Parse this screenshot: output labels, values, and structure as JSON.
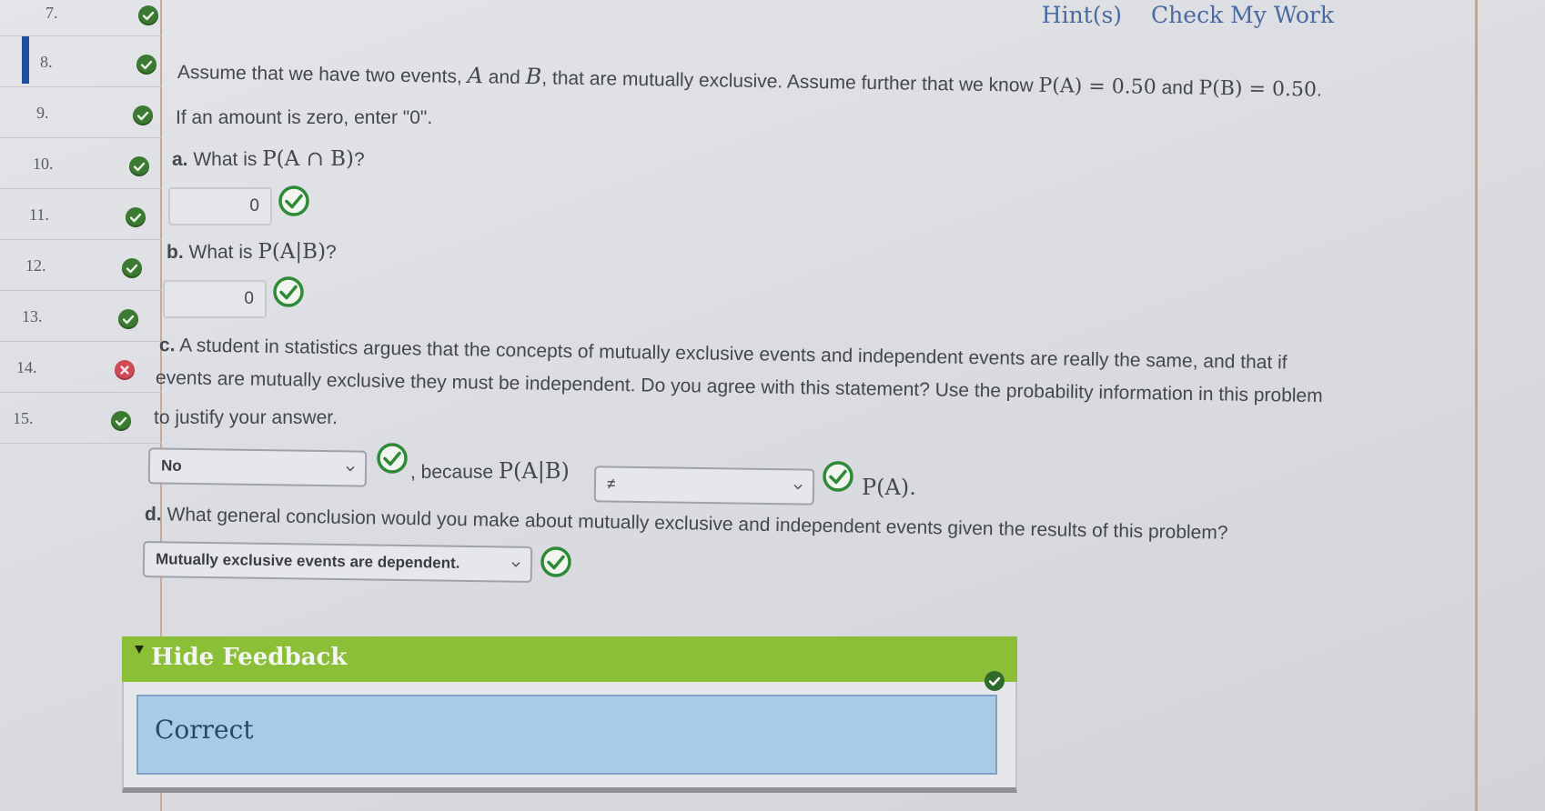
{
  "sidebar": {
    "active_question": "8.",
    "items": [
      {
        "label": "7.",
        "status": "correct"
      },
      {
        "label": "8.",
        "status": "correct"
      },
      {
        "label": "9.",
        "status": "correct"
      },
      {
        "label": "10.",
        "status": "correct"
      },
      {
        "label": "11.",
        "status": "correct"
      },
      {
        "label": "12.",
        "status": "correct"
      },
      {
        "label": "13.",
        "status": "correct"
      },
      {
        "label": "14.",
        "status": "incorrect"
      },
      {
        "label": "15.",
        "status": "correct"
      }
    ]
  },
  "header": {
    "hints_label": "Hint(s)",
    "check_label": "Check My Work"
  },
  "problem": {
    "intro_1": "Assume that we have two events, ",
    "var_a": "A",
    "and": " and ",
    "var_b": "B",
    "intro_2": ", that are mutually exclusive. Assume further that we know ",
    "pa": "P(A) = 0.50",
    "and2": " and ",
    "pb": "P(B) = 0.50",
    "period": ".",
    "instruction": "If an amount is zero, enter \"0\".",
    "part_a": {
      "label": "a.",
      "question": " What is ",
      "expr": "P(A ∩ B)",
      "q": "?",
      "answer": "0",
      "status": "correct"
    },
    "part_b": {
      "label": "b.",
      "question": " What is ",
      "expr": "P(A|B)",
      "q": "?",
      "answer": "0",
      "status": "correct"
    },
    "part_c": {
      "label": "c.",
      "line1": " A student in statistics argues that the concepts of mutually exclusive events and independent events are really the same, and that if",
      "line2": "events are mutually exclusive they must be independent. Do you agree with this statement? Use the probability information in this problem",
      "line3": "to justify your answer.",
      "select_1": "No",
      "because": ", because ",
      "expr": "P(A|B)",
      "select_2": "≠",
      "tail": "P(A).",
      "status": "correct"
    },
    "part_d": {
      "label": "d.",
      "question": " What general conclusion would you make about mutually exclusive and independent events given the results of this problem?",
      "select": "Mutually exclusive events are dependent.",
      "status": "correct"
    }
  },
  "feedback": {
    "toggle_label": "Hide Feedback",
    "message": "Correct"
  },
  "colors": {
    "correct": "#3c7a34",
    "incorrect": "#cf4a55",
    "link": "#4a6aa0",
    "feedback_header": "#8abf37",
    "feedback_body": "#a9cbe6",
    "active_marker": "#1d4f9e"
  }
}
